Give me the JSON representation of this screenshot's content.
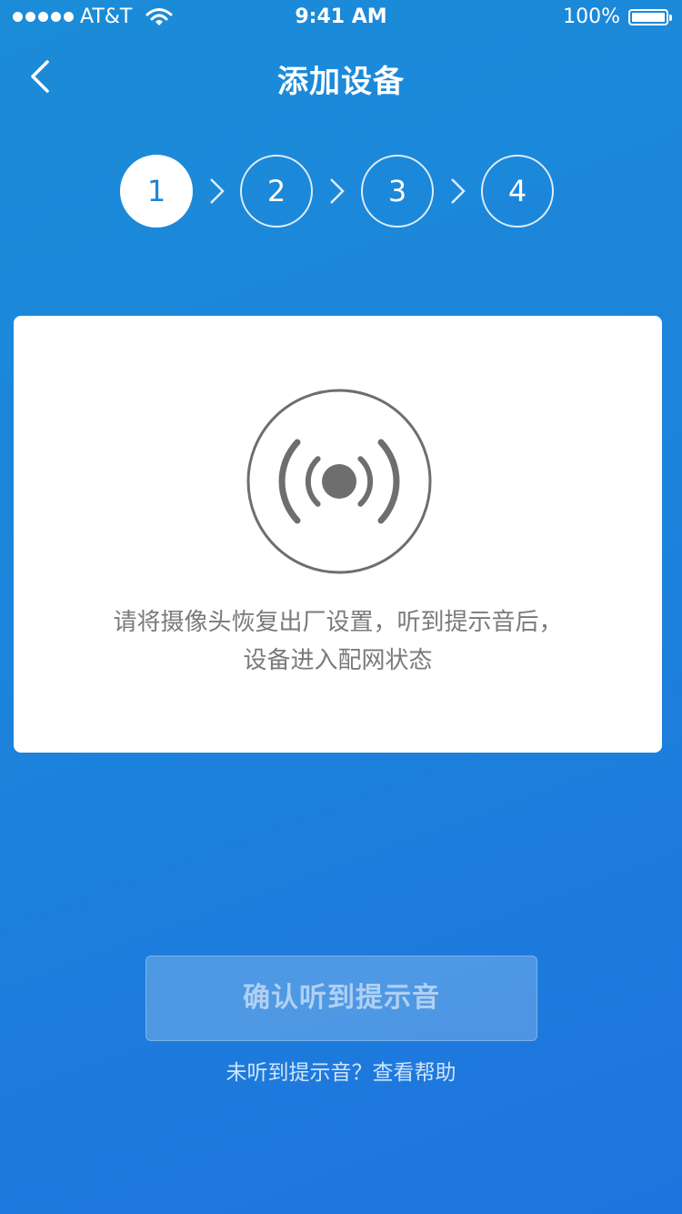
{
  "status_bar": {
    "carrier": "AT&T",
    "time": "9:41 AM",
    "battery": "100%"
  },
  "nav": {
    "title": "添加设备"
  },
  "steps": [
    {
      "label": "1",
      "active": true
    },
    {
      "label": "2",
      "active": false
    },
    {
      "label": "3",
      "active": false
    },
    {
      "label": "4",
      "active": false
    }
  ],
  "card": {
    "icon": "sound-wave-icon",
    "instruction_line1": "请将摄像头恢复出厂设置，听到提示音后，",
    "instruction_line2": "设备进入配网状态"
  },
  "actions": {
    "confirm_label": "确认听到提示音",
    "help_link": "未听到提示音？查看帮助"
  },
  "colors": {
    "background_start": "#1b8cd8",
    "background_end": "#1e74de",
    "icon_gray": "#6e6e6e",
    "text_gray": "#7a7a7a"
  }
}
